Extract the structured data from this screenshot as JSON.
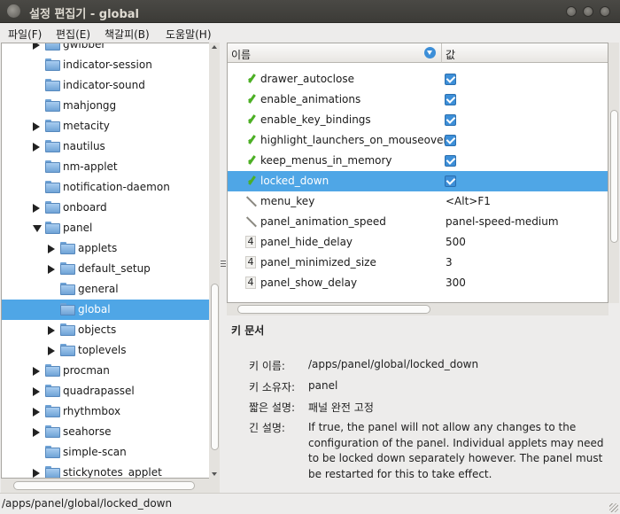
{
  "window": {
    "title": "설정 편집기 - global"
  },
  "menu": [
    {
      "label": "파일(F)"
    },
    {
      "label": "편집(E)"
    },
    {
      "label": "책갈피(B)"
    },
    {
      "label": "도움말(H)"
    }
  ],
  "tree": [
    {
      "label": "gwibber",
      "expander": "closed",
      "depth": 0
    },
    {
      "label": "indicator-session",
      "expander": "none",
      "depth": 0
    },
    {
      "label": "indicator-sound",
      "expander": "none",
      "depth": 0
    },
    {
      "label": "mahjongg",
      "expander": "none",
      "depth": 0
    },
    {
      "label": "metacity",
      "expander": "closed",
      "depth": 0
    },
    {
      "label": "nautilus",
      "expander": "closed",
      "depth": 0
    },
    {
      "label": "nm-applet",
      "expander": "none",
      "depth": 0
    },
    {
      "label": "notification-daemon",
      "expander": "none",
      "depth": 0
    },
    {
      "label": "onboard",
      "expander": "closed",
      "depth": 0
    },
    {
      "label": "panel",
      "expander": "open",
      "depth": 0
    },
    {
      "label": "applets",
      "expander": "closed",
      "depth": 1
    },
    {
      "label": "default_setup",
      "expander": "closed",
      "depth": 1
    },
    {
      "label": "general",
      "expander": "none",
      "depth": 1
    },
    {
      "label": "global",
      "expander": "none",
      "depth": 1,
      "selected": true
    },
    {
      "label": "objects",
      "expander": "closed",
      "depth": 1
    },
    {
      "label": "toplevels",
      "expander": "closed",
      "depth": 1
    },
    {
      "label": "procman",
      "expander": "closed",
      "depth": 0
    },
    {
      "label": "quadrapassel",
      "expander": "closed",
      "depth": 0
    },
    {
      "label": "rhythmbox",
      "expander": "closed",
      "depth": 0
    },
    {
      "label": "seahorse",
      "expander": "closed",
      "depth": 0
    },
    {
      "label": "simple-scan",
      "expander": "none",
      "depth": 0
    },
    {
      "label": "stickynotes_applet",
      "expander": "closed",
      "depth": 0
    }
  ],
  "list": {
    "columns": {
      "name": "이름",
      "value": "값"
    },
    "rows": [
      {
        "type": "bool",
        "name": "drawer_autoclose",
        "value": true
      },
      {
        "type": "bool",
        "name": "enable_animations",
        "value": true
      },
      {
        "type": "bool",
        "name": "enable_key_bindings",
        "value": true
      },
      {
        "type": "bool",
        "name": "highlight_launchers_on_mouseover",
        "value": true
      },
      {
        "type": "bool",
        "name": "keep_menus_in_memory",
        "value": true
      },
      {
        "type": "bool",
        "name": "locked_down",
        "value": true,
        "selected": true
      },
      {
        "type": "string",
        "name": "menu_key",
        "value": "<Alt>F1"
      },
      {
        "type": "string",
        "name": "panel_animation_speed",
        "value": "panel-speed-medium"
      },
      {
        "type": "int",
        "name": "panel_hide_delay",
        "value": "500"
      },
      {
        "type": "int",
        "name": "panel_minimized_size",
        "value": "3"
      },
      {
        "type": "int",
        "name": "panel_show_delay",
        "value": "300"
      }
    ],
    "type_glyph_int": "4"
  },
  "doc": {
    "title": "키 문서",
    "key_name_label": "키 이름:",
    "key_name": "/apps/panel/global/locked_down",
    "owner_label": "키 소유자:",
    "owner": "panel",
    "short_label": "짧은 설명:",
    "short": "패널 완전 고정",
    "long_label": "긴 설명:",
    "long": "If true, the panel will not allow any changes to the configuration of the panel. Individual applets may need to be locked down separately however. The panel must be restarted for this to take effect."
  },
  "status": {
    "path": "/apps/panel/global/locked_down"
  },
  "colors": {
    "selection": "#4fa6e6",
    "titlebar": "#3c3b37",
    "check": "#4caf25"
  }
}
